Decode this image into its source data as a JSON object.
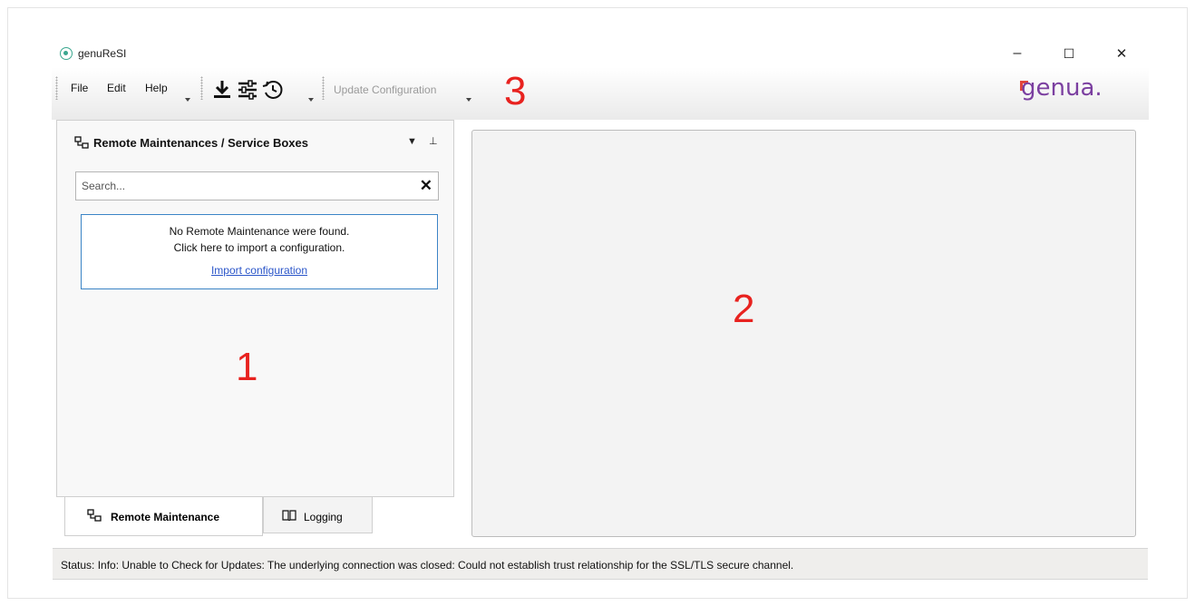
{
  "window": {
    "title": "genuReSI",
    "controls": {
      "minimize": "–",
      "maximize": "☐",
      "close": "✕"
    }
  },
  "menu": {
    "items": [
      "File",
      "Edit",
      "Help"
    ]
  },
  "toolbar": {
    "icons": [
      "download-icon",
      "settings-sliders-icon",
      "history-icon"
    ],
    "update_configuration_label": "Update Configuration"
  },
  "logo": {
    "text": "genua."
  },
  "markers": {
    "left_panel": "1",
    "content_area": "2",
    "toolbar": "3"
  },
  "left_panel": {
    "title": "Remote Maintenances / Service Boxes",
    "menu_glyph": "▼",
    "pin_glyph": "⊥",
    "search": {
      "placeholder": "Search...",
      "value": ""
    },
    "info": {
      "line1": "No  Remote Maintenance were found.",
      "line2": "Click here to import a configuration.",
      "link": "Import configuration"
    },
    "tabs": [
      {
        "label": "Remote Maintenance",
        "icon": "network-icon",
        "active": true
      },
      {
        "label": "Logging",
        "icon": "book-icon",
        "active": false
      }
    ]
  },
  "status": {
    "text": "Status: Info: Unable to Check for Updates: The underlying connection was closed: Could not establish trust relationship for the SSL/TLS secure channel."
  },
  "colors": {
    "marker": "#e8221f",
    "logo": "#7b3fa0",
    "logo_accent": "#e2453b",
    "link": "#2a55c9",
    "info_border": "#3b84c6",
    "app_icon": "#3aa78f"
  }
}
